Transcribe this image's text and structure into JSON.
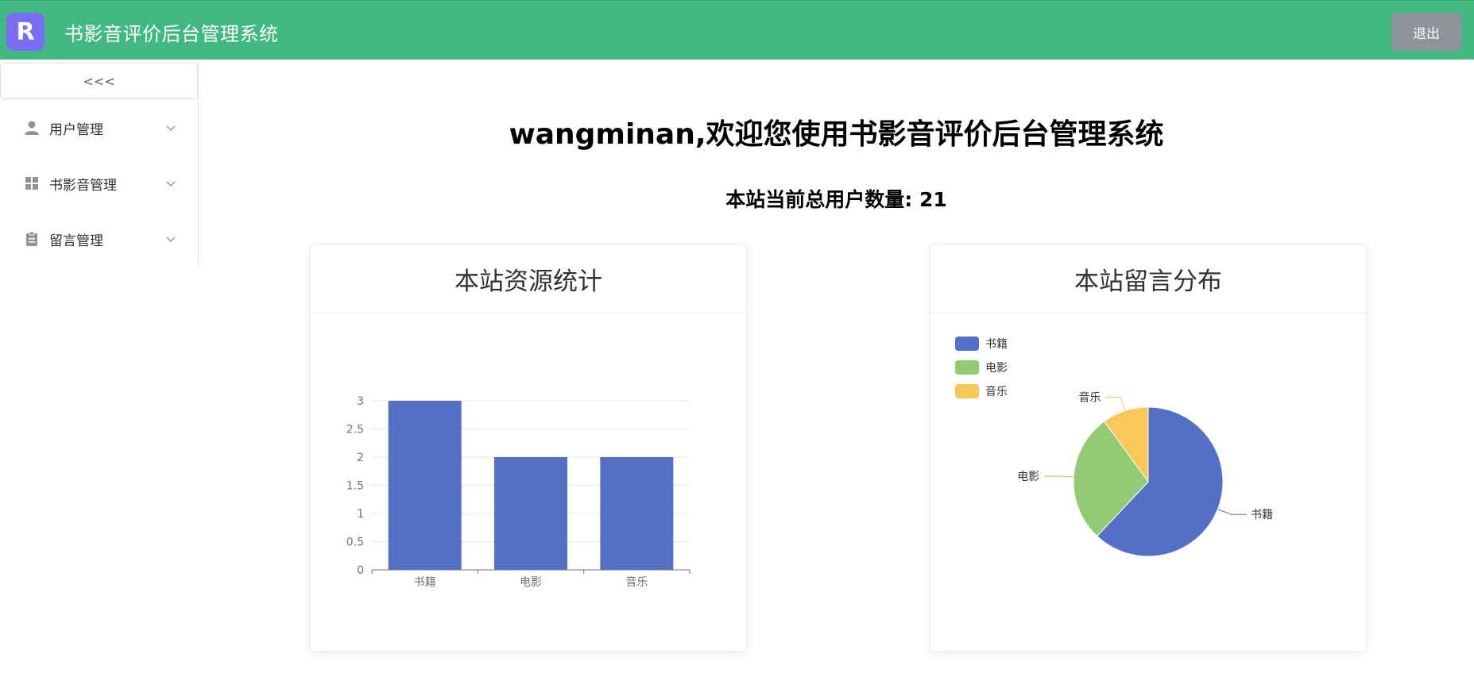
{
  "header": {
    "logo_letter": "R",
    "title": "书影音评价后台管理系统",
    "logout_label": "退出"
  },
  "sidebar": {
    "collapse_label": "<<<",
    "items": [
      {
        "label": "用户管理",
        "icon": "user-icon"
      },
      {
        "label": "书影音管理",
        "icon": "grid-icon"
      },
      {
        "label": "留言管理",
        "icon": "clipboard-icon"
      }
    ]
  },
  "main": {
    "welcome": "wangminan,欢迎您使用书影音评价后台管理系统",
    "user_count": "本站当前总用户数量: 21"
  },
  "chart_data": [
    {
      "type": "bar",
      "title": "本站资源统计",
      "categories": [
        "书籍",
        "电影",
        "音乐"
      ],
      "values": [
        3,
        2,
        2
      ],
      "ylim": [
        0,
        3
      ],
      "yticks": [
        "0",
        "0.5",
        "1",
        "1.5",
        "2",
        "2.5",
        "3"
      ],
      "color": "#5470c6",
      "grid": true
    },
    {
      "type": "pie",
      "title": "本站留言分布",
      "legend_position": "top-left",
      "slices": [
        {
          "label": "书籍",
          "value": 62,
          "color": "#5470c6"
        },
        {
          "label": "电影",
          "value": 28,
          "color": "#91cc75"
        },
        {
          "label": "音乐",
          "value": 10,
          "color": "#fac858"
        }
      ]
    }
  ]
}
